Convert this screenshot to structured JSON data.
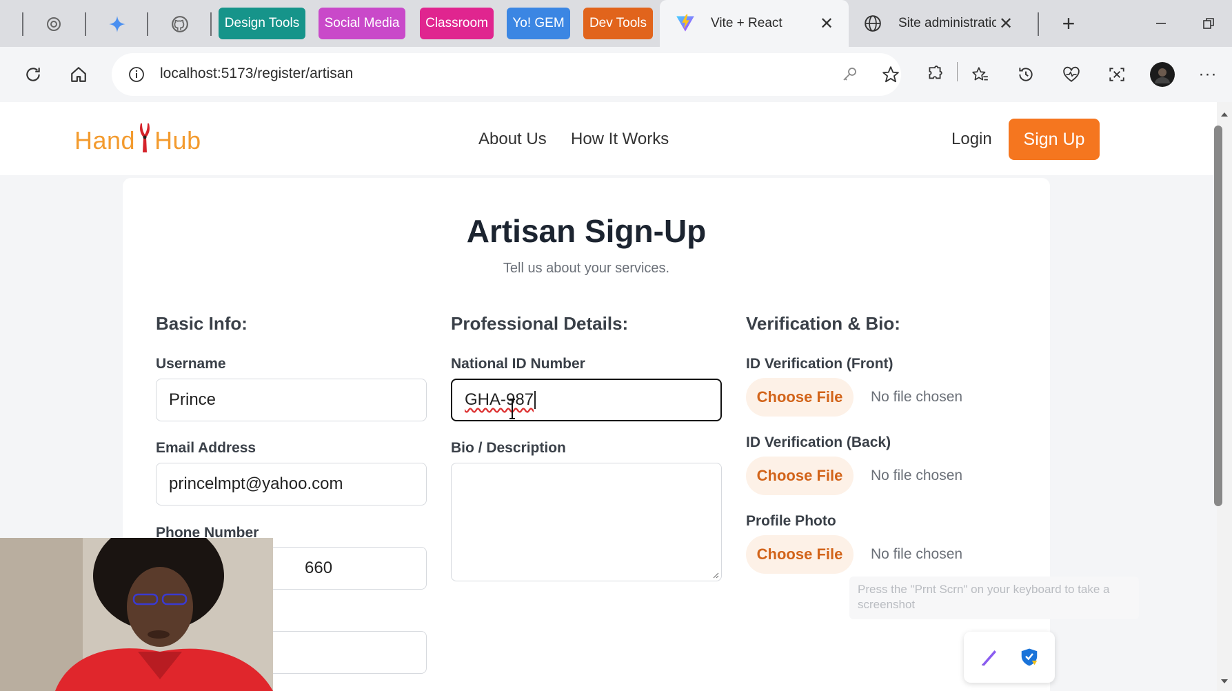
{
  "browser": {
    "group_tabs": [
      {
        "label": "Design Tools",
        "color": "#16948a"
      },
      {
        "label": "Social Media",
        "color": "#c949c9"
      },
      {
        "label": "Classroom",
        "color": "#e0258f"
      },
      {
        "label": "Yo! GEM",
        "color": "#3b86e3"
      },
      {
        "label": "Dev Tools",
        "color": "#e1641c"
      }
    ],
    "tabs": [
      {
        "title": "Vite + React",
        "icon": "vite-icon",
        "active": true
      },
      {
        "title": "Site administratio",
        "icon": "globe-icon",
        "active": false
      }
    ],
    "url": "localhost:5173/register/artisan"
  },
  "site": {
    "logo_left": "Hand",
    "logo_right": "Hub",
    "logo_icon": "pliers-icon",
    "nav": [
      "About Us",
      "How It Works"
    ],
    "login": "Login",
    "signup": "Sign Up",
    "accent_color": "#f5761f"
  },
  "form": {
    "title": "Artisan Sign-Up",
    "subtitle": "Tell us about your services.",
    "basic": {
      "heading": "Basic Info:",
      "username_label": "Username",
      "username_value": "Prince",
      "email_label": "Email Address",
      "email_value": "princelmpt@yahoo.com",
      "phone_label": "Phone Number",
      "phone_value_visible": "660"
    },
    "professional": {
      "heading": "Professional Details:",
      "national_id_label": "National ID Number",
      "national_id_value": "GHA-987",
      "bio_label": "Bio / Description",
      "bio_value": ""
    },
    "verification": {
      "heading": "Verification & Bio:",
      "front_label": "ID Verification (Front)",
      "back_label": "ID Verification (Back)",
      "photo_label": "Profile Photo",
      "choose_file": "Choose File",
      "no_file": "No file chosen"
    }
  },
  "overlay": {
    "tooltip": "Press the \"Prnt Scrn\" on your keyboard to take a screenshot"
  }
}
